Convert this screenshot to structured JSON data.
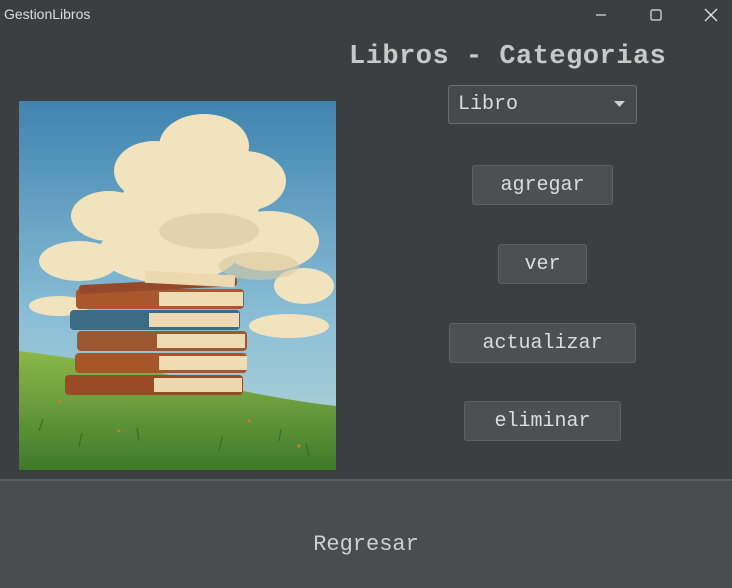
{
  "window": {
    "title": "GestionLibros"
  },
  "heading": "Libros - Categorias",
  "selector": {
    "value": "Libro"
  },
  "actions": {
    "add": "agregar",
    "view": "ver",
    "update": "actualizar",
    "delete": "eliminar"
  },
  "footer": {
    "back": "Regresar"
  },
  "icons": [
    "minimize-icon",
    "maximize-icon",
    "close-icon",
    "chevron-down-icon"
  ]
}
